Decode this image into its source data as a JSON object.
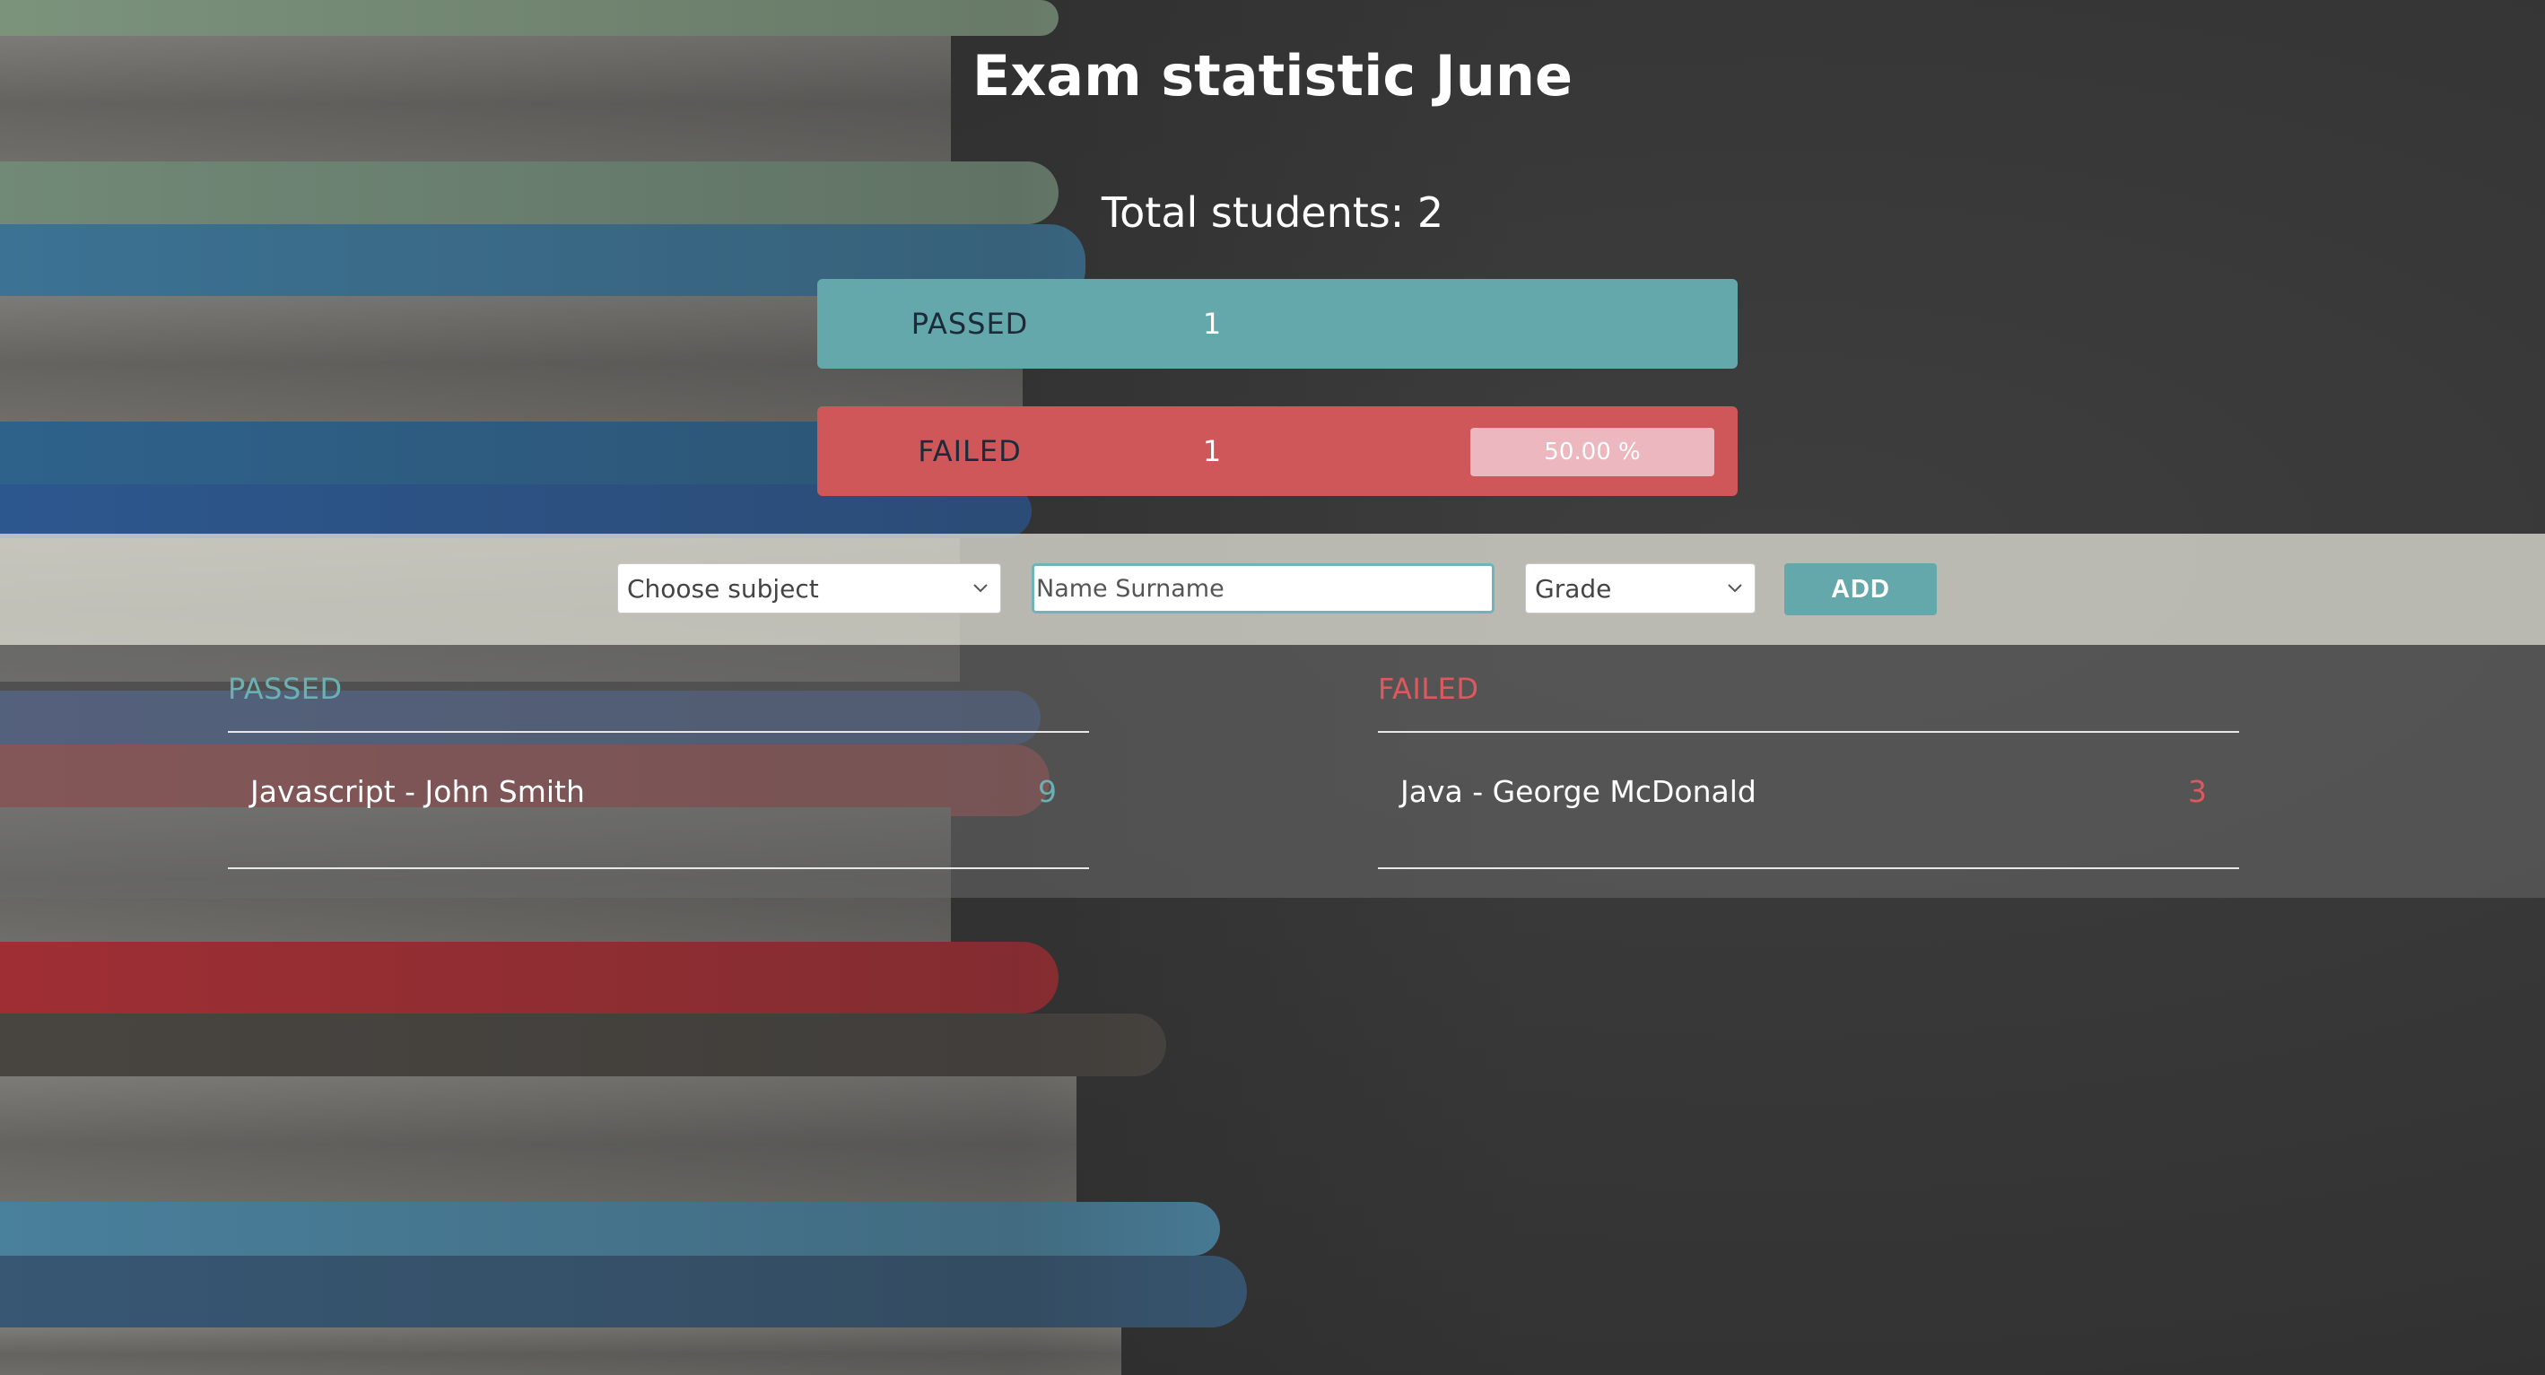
{
  "header": {
    "title": "Exam statistic June",
    "total_students": "Total students: 2"
  },
  "stats": {
    "passed": {
      "label": "PASSED",
      "count": "1"
    },
    "failed": {
      "label": "FAILED",
      "count": "1",
      "percent": "50.00 %"
    }
  },
  "form": {
    "subject_select": {
      "selected": "Choose subject"
    },
    "name_input": {
      "placeholder": "Name Surname",
      "value": ""
    },
    "grade_select": {
      "selected": "Grade"
    },
    "add_label": "ADD"
  },
  "results": {
    "passed": {
      "heading": "PASSED",
      "rows": [
        {
          "name": "Javascript - John Smith",
          "grade": "9"
        }
      ]
    },
    "failed": {
      "heading": "FAILED",
      "rows": [
        {
          "name": "Java - George McDonald",
          "grade": "3"
        }
      ]
    }
  },
  "colors": {
    "passed": "#65a8ab",
    "failed": "#cf5659",
    "percent_badge": "#ecb7be",
    "form_strip": "#d6d6cc",
    "focus_border": "#6fb4ba"
  },
  "icons": {
    "select_arrow": "chevron-down-icon"
  }
}
